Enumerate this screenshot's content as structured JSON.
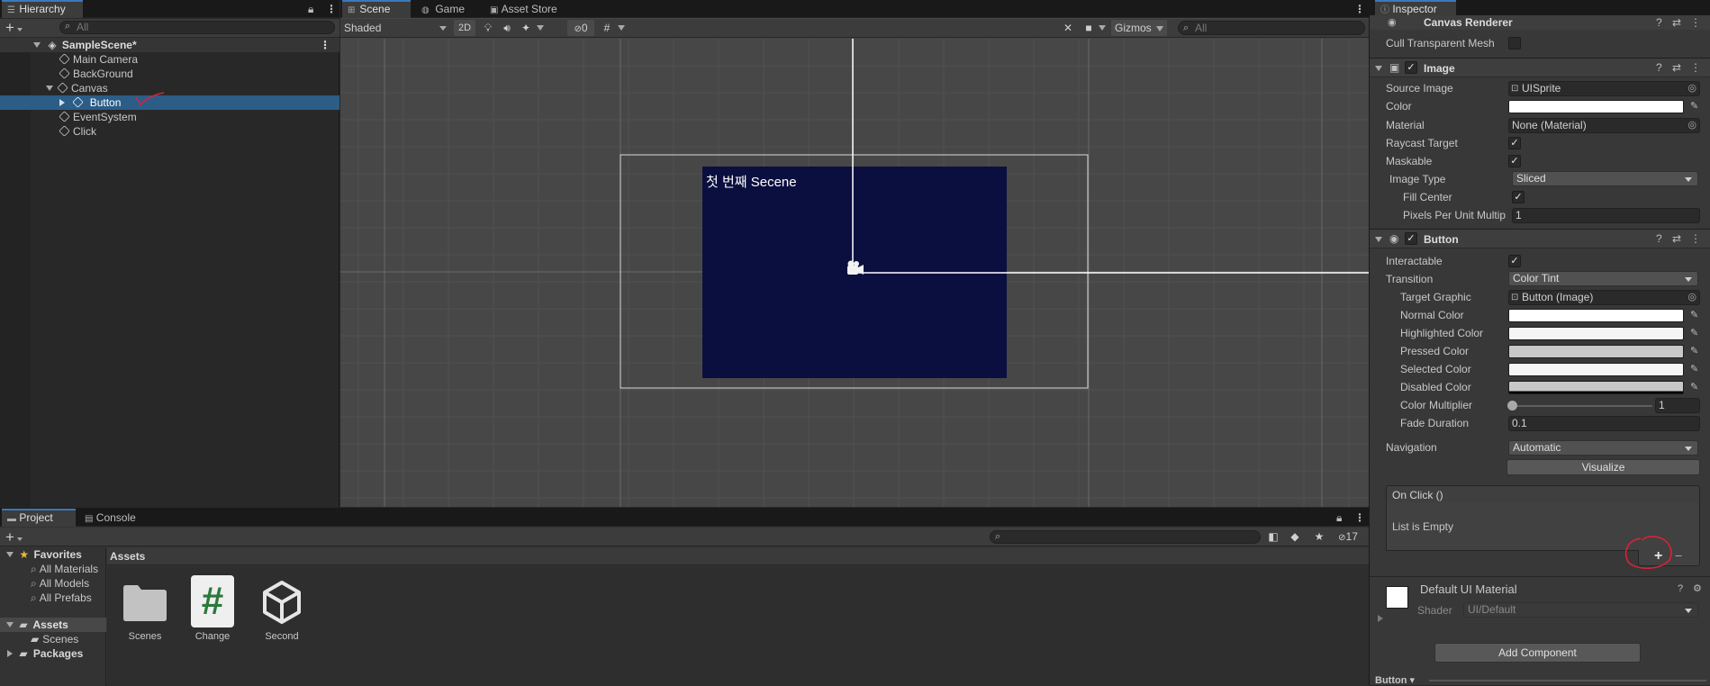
{
  "hierarchy": {
    "tab": "Hierarchy",
    "search_placeholder": "All",
    "scene_name": "SampleScene*",
    "items": [
      "Main Camera",
      "BackGround",
      "Canvas",
      "Button",
      "EventSystem",
      "Click"
    ]
  },
  "scene": {
    "tabs": [
      "Scene",
      "Game",
      "Asset Store"
    ],
    "shading_mode": "Shaded",
    "toggle_2d": "2D",
    "hidden_count": "0",
    "gizmos_label": "Gizmos",
    "search_placeholder": "All",
    "canvas_text": "첫 번째 Secene"
  },
  "inspector": {
    "tab": "Inspector",
    "canvas_renderer": {
      "title": "Canvas Renderer",
      "cull_label": "Cull Transparent Mesh"
    },
    "image": {
      "title": "Image",
      "source_image_label": "Source Image",
      "source_image_value": "UISprite",
      "color_label": "Color",
      "material_label": "Material",
      "material_value": "None (Material)",
      "raycast_label": "Raycast Target",
      "maskable_label": "Maskable",
      "image_type_label": "Image Type",
      "image_type_value": "Sliced",
      "fill_center_label": "Fill Center",
      "ppu_label": "Pixels Per Unit Multip",
      "ppu_value": "1"
    },
    "button": {
      "title": "Button",
      "interactable_label": "Interactable",
      "transition_label": "Transition",
      "transition_value": "Color Tint",
      "target_graphic_label": "Target Graphic",
      "target_graphic_value": "Button (Image)",
      "normal_label": "Normal Color",
      "highlighted_label": "Highlighted Color",
      "pressed_label": "Pressed Color",
      "selected_label": "Selected Color",
      "disabled_label": "Disabled Color",
      "multiplier_label": "Color Multiplier",
      "multiplier_value": "1",
      "fade_label": "Fade Duration",
      "fade_value": "0.1",
      "navigation_label": "Navigation",
      "navigation_value": "Automatic",
      "visualize_label": "Visualize",
      "onclick_title": "On Click ()",
      "onclick_empty": "List is Empty",
      "add_symbol": "+",
      "remove_symbol": "−"
    },
    "material": {
      "name": "Default UI Material",
      "shader_label": "Shader",
      "shader_value": "UI/Default"
    },
    "add_component_label": "Add Component",
    "bottom_tab": "Button ▾"
  },
  "project": {
    "tabs": [
      "Project",
      "Console"
    ],
    "hidden_count": "17",
    "favorites_label": "Favorites",
    "favorites": [
      "All Materials",
      "All Models",
      "All Prefabs"
    ],
    "assets_label": "Assets",
    "asset_folders": [
      "Scenes"
    ],
    "packages_label": "Packages",
    "breadcrumb": "Assets",
    "files": [
      "Scenes",
      "Change",
      "Second"
    ],
    "script_glyph": "#"
  },
  "colors": {
    "accent": "#3a79bb",
    "selection": "#2c5d87",
    "canvas_image": "#0b0f3f",
    "annotation": "#e0203a"
  }
}
